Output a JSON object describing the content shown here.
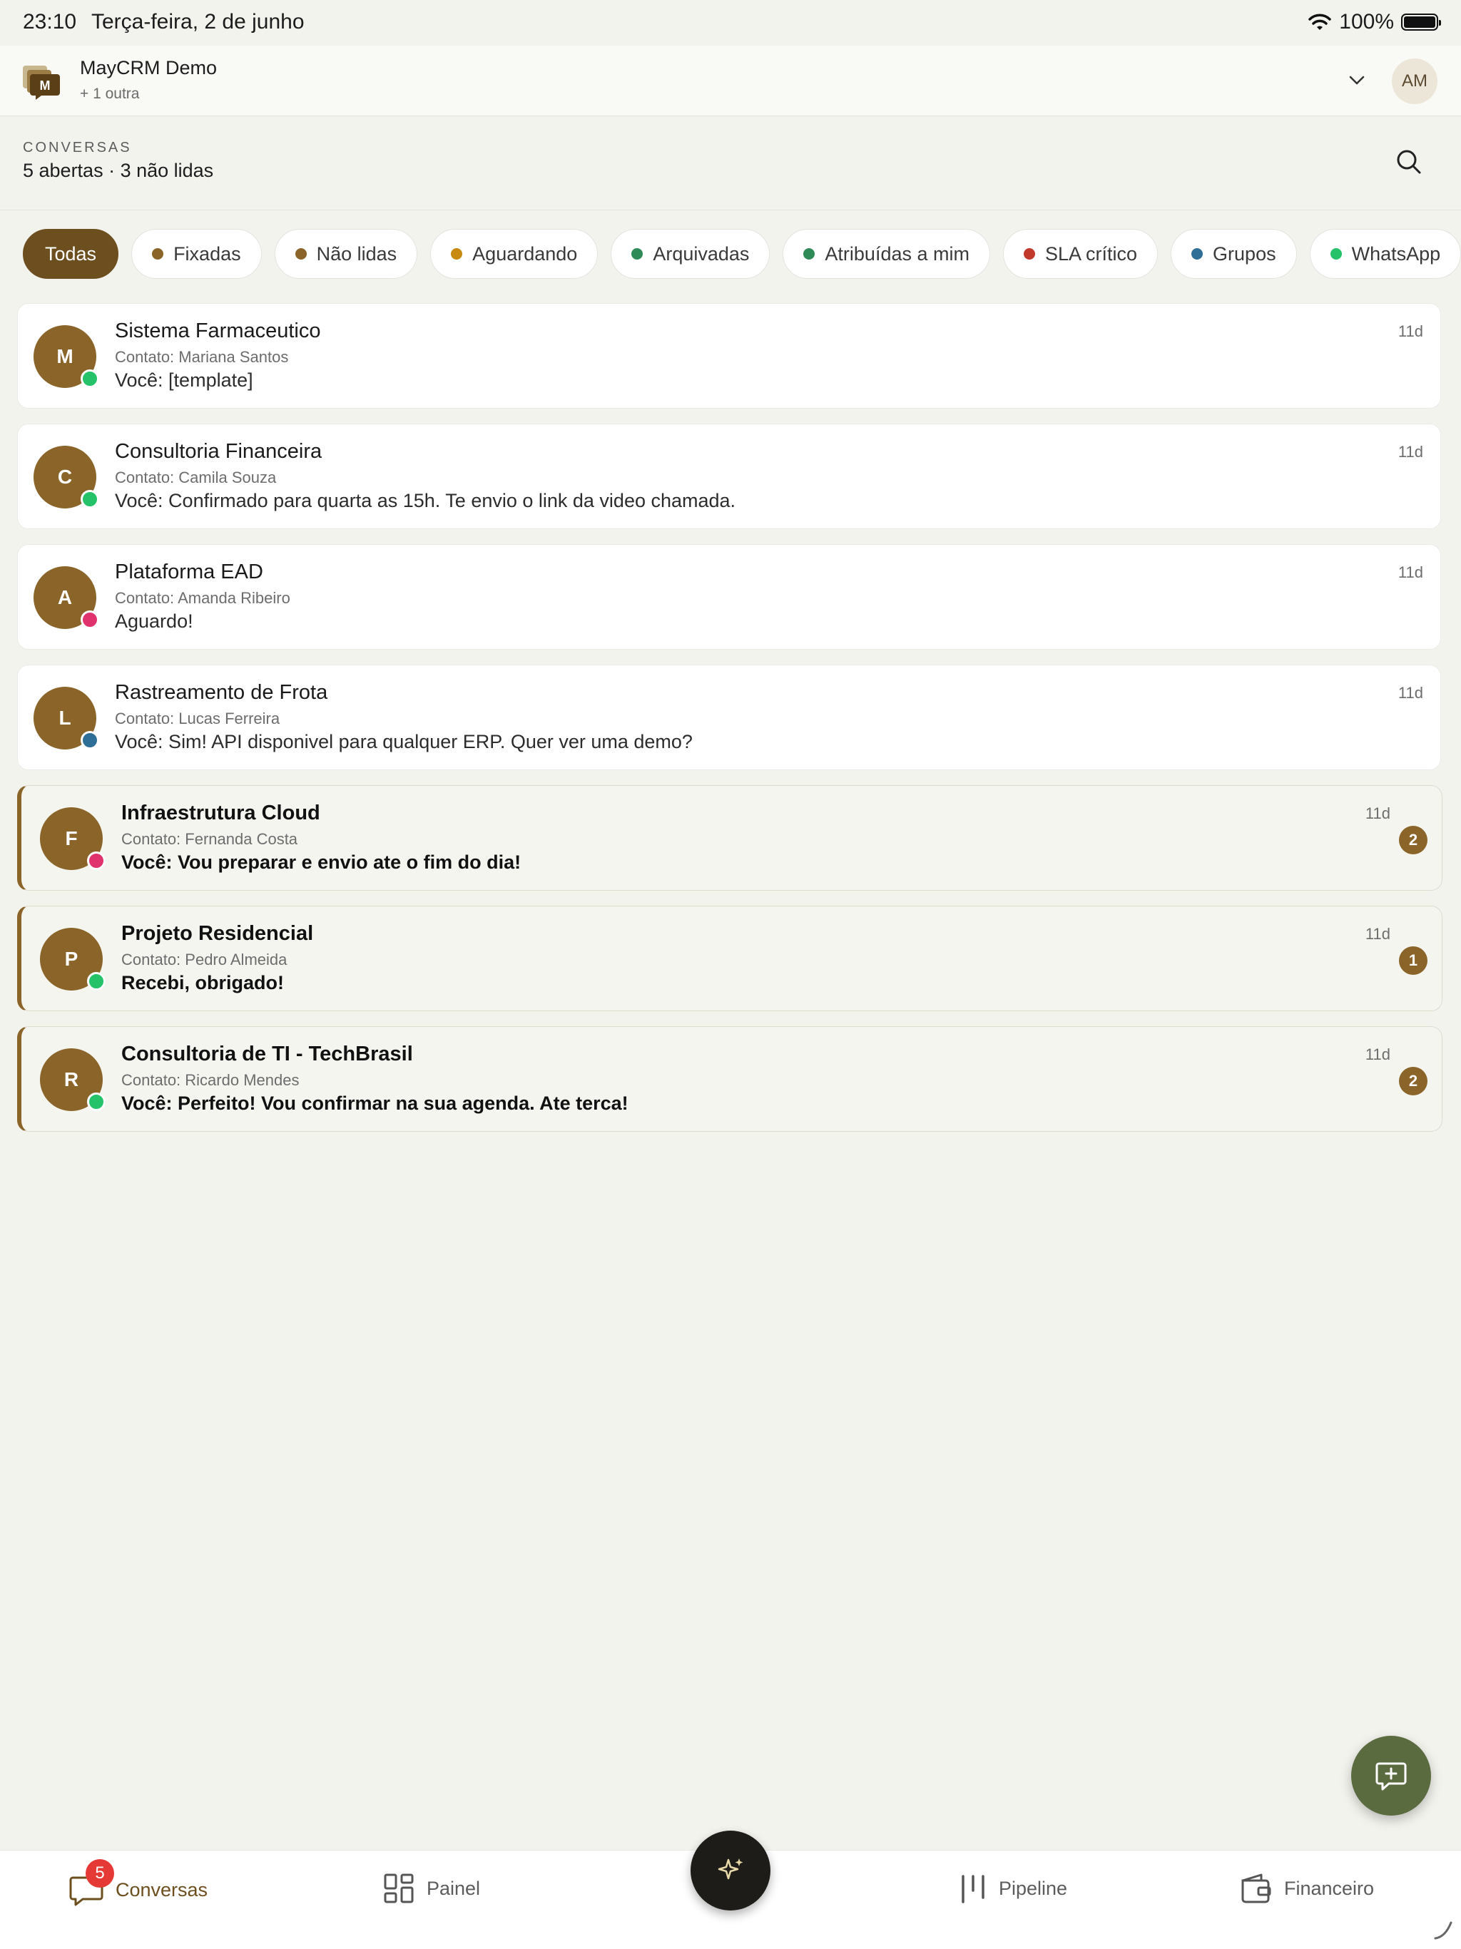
{
  "status_bar": {
    "time": "23:10",
    "date": "Terça-feira, 2 de junho",
    "battery": "100%"
  },
  "header": {
    "org_name": "MayCRM Demo",
    "org_sub": "+ 1 outra",
    "user_initials": "AM",
    "logo_letter": "M"
  },
  "section": {
    "label": "CONVERSAS",
    "summary": "5 abertas · 3 não lidas"
  },
  "filters": [
    {
      "label": "Todas",
      "color": ""
    },
    {
      "label": "Fixadas",
      "color": "#8a6428"
    },
    {
      "label": "Não lidas",
      "color": "#8a6428"
    },
    {
      "label": "Aguardando",
      "color": "#c98a12"
    },
    {
      "label": "Arquivadas",
      "color": "#2e8b57"
    },
    {
      "label": "Atribuídas a mim",
      "color": "#2e8b57"
    },
    {
      "label": "SLA crítico",
      "color": "#c0392b"
    },
    {
      "label": "Grupos",
      "color": "#2f6f97"
    },
    {
      "label": "WhatsApp",
      "color": "#25c26a"
    }
  ],
  "conversations": [
    {
      "initial": "M",
      "title": "Sistema Farmaceutico",
      "contact": "Contato: Mariana Santos",
      "message": "Você: [template]",
      "time": "11d",
      "status_color": "#25c26a",
      "unread": ""
    },
    {
      "initial": "C",
      "title": "Consultoria Financeira",
      "contact": "Contato: Camila Souza",
      "message": "Você: Confirmado para quarta as 15h. Te envio o link da video chamada.",
      "time": "11d",
      "status_color": "#25c26a",
      "unread": ""
    },
    {
      "initial": "A",
      "title": "Plataforma EAD",
      "contact": "Contato: Amanda Ribeiro",
      "message": "Aguardo!",
      "time": "11d",
      "status_color": "#e0336d",
      "unread": ""
    },
    {
      "initial": "L",
      "title": "Rastreamento de Frota",
      "contact": "Contato: Lucas Ferreira",
      "message": "Você: Sim! API disponivel para qualquer ERP. Quer ver uma demo?",
      "time": "11d",
      "status_color": "#2f6f97",
      "unread": ""
    },
    {
      "initial": "F",
      "title": "Infraestrutura Cloud",
      "contact": "Contato: Fernanda Costa",
      "message": "Você: Vou preparar e envio ate o fim do dia!",
      "time": "11d",
      "status_color": "#e0336d",
      "unread": "2"
    },
    {
      "initial": "P",
      "title": "Projeto Residencial",
      "contact": "Contato: Pedro Almeida",
      "message": "Recebi, obrigado!",
      "time": "11d",
      "status_color": "#25c26a",
      "unread": "1"
    },
    {
      "initial": "R",
      "title": "Consultoria de TI - TechBrasil",
      "contact": "Contato: Ricardo Mendes",
      "message": "Você: Perfeito! Vou confirmar na sua agenda. Ate terca!",
      "time": "11d",
      "status_color": "#25c26a",
      "unread": "2"
    }
  ],
  "tabbar": {
    "conversas": "Conversas",
    "conversas_badge": "5",
    "painel": "Painel",
    "pipeline": "Pipeline",
    "financeiro": "Financeiro"
  },
  "colors": {
    "brand": "#6d4f1f",
    "accent": "#8a6428",
    "fab": "#5a6b3f"
  }
}
